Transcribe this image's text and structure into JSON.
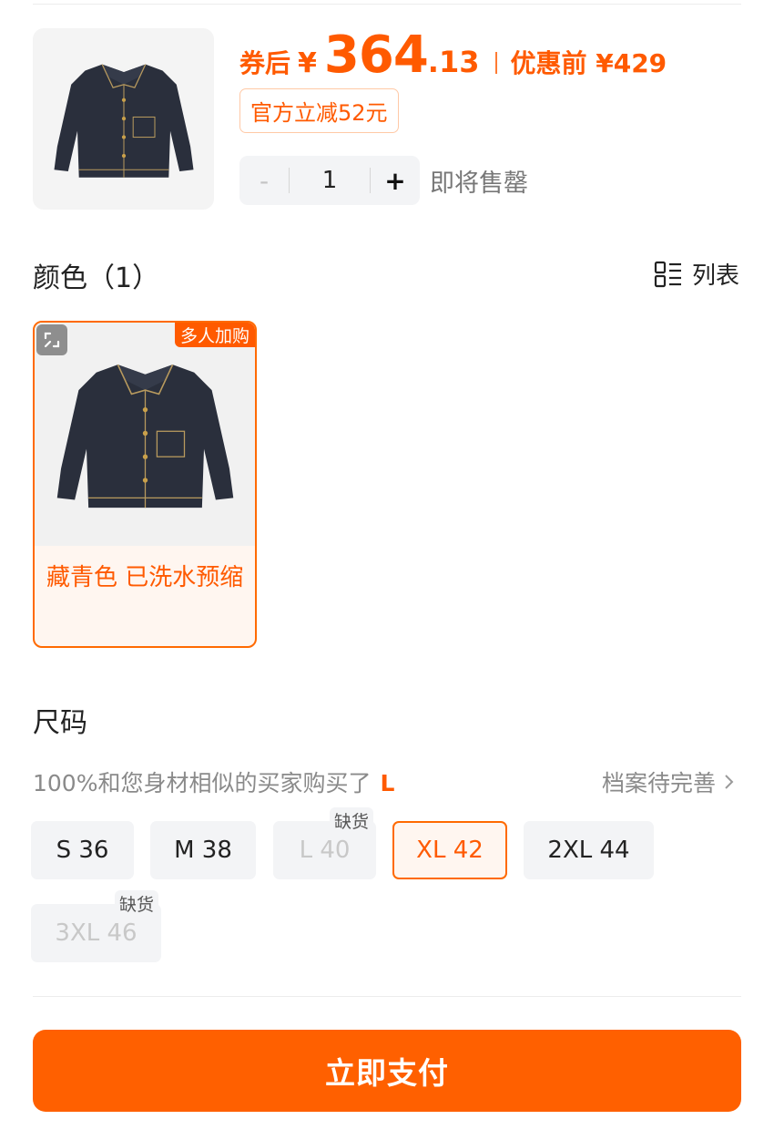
{
  "price": {
    "prefix": "券后",
    "currency": "¥",
    "integer": "364",
    "decimal": ".13",
    "original_label": "优惠前 ¥429"
  },
  "discount_tag": "官方立减52元",
  "quantity": {
    "minus": "-",
    "value": "1",
    "plus": "+",
    "stock_note": "即将售罄"
  },
  "color_section": {
    "title": "颜色（1）",
    "list_toggle": "列表",
    "options": [
      {
        "name": "藏青色 已洗水预缩",
        "badge": "多人加购",
        "selected": true
      }
    ]
  },
  "size_section": {
    "title": "尺码",
    "hint_text": "100%和您身材相似的买家购买了",
    "hint_size": "L",
    "profile_link": "档案待完善",
    "options": [
      {
        "label": "S 36",
        "state": "normal"
      },
      {
        "label": "M 38",
        "state": "normal"
      },
      {
        "label": "L 40",
        "state": "out_of_stock",
        "tag": "缺货"
      },
      {
        "label": "XL 42",
        "state": "selected"
      },
      {
        "label": "2XL 44",
        "state": "normal"
      },
      {
        "label": "3XL 46",
        "state": "out_of_stock",
        "tag": "缺货"
      }
    ]
  },
  "pay_button": "立即支付",
  "colors": {
    "accent": "#ff5a00",
    "pay_button": "#ff6000",
    "chip_bg": "#f3f4f6",
    "jacket": "#2a2f3c"
  },
  "icons": [
    "jacket-image",
    "list-view-icon",
    "expand-icon",
    "chevron-right-icon"
  ]
}
